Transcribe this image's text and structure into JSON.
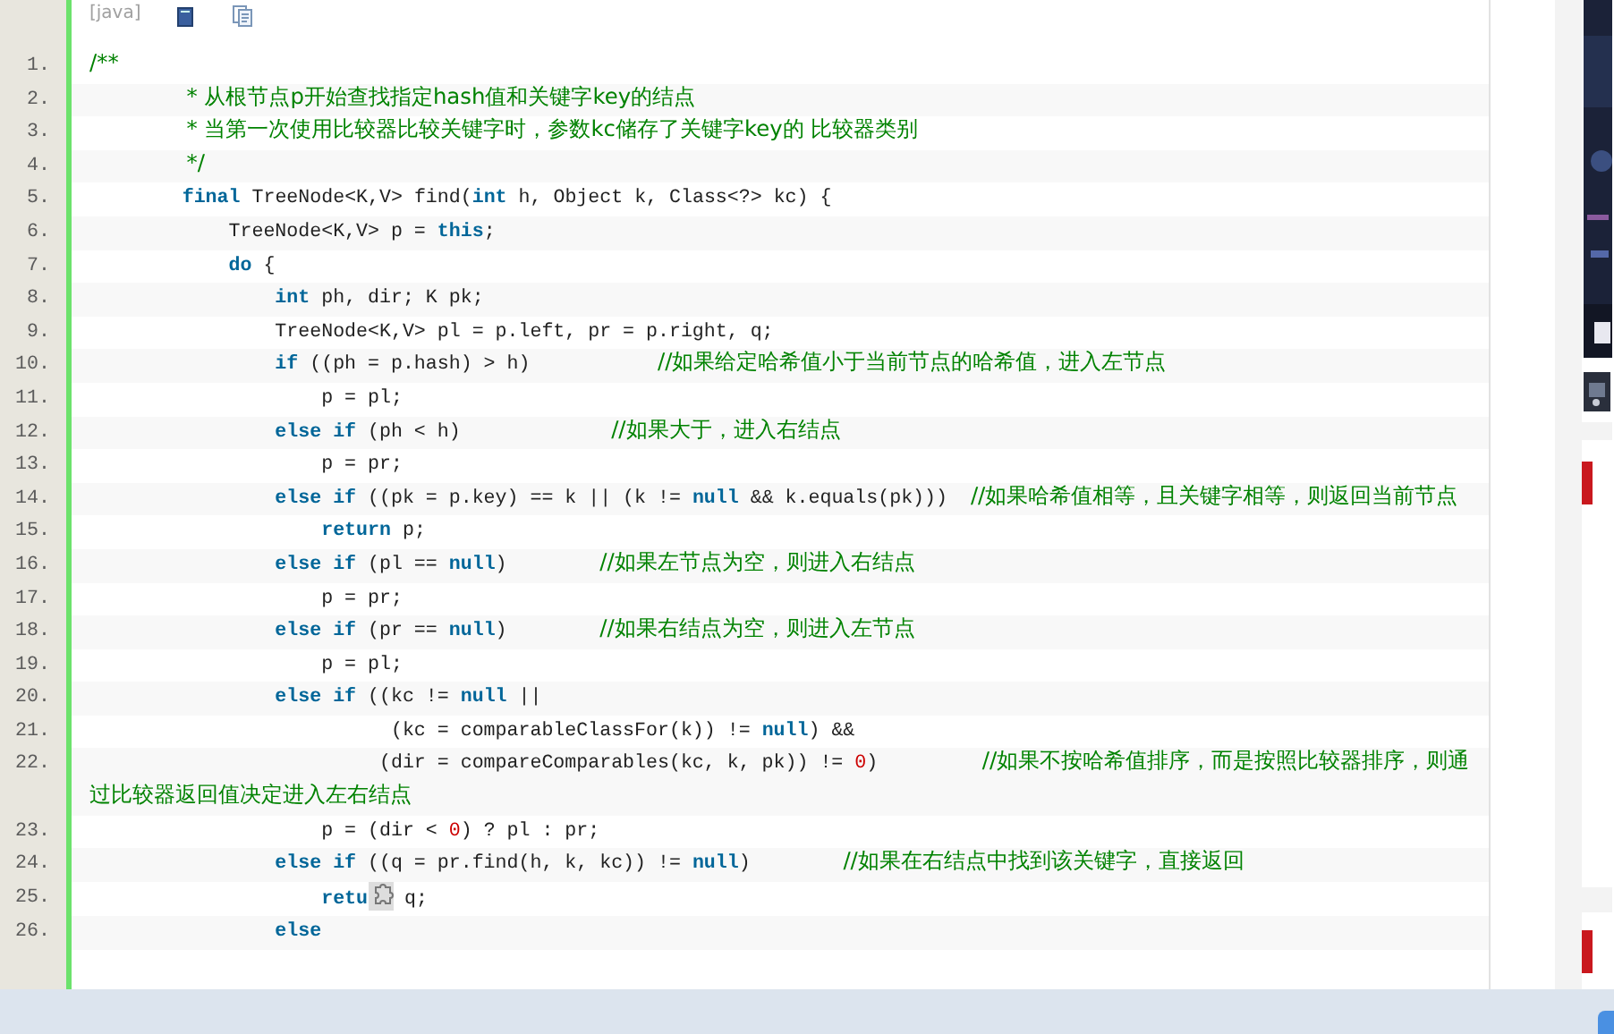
{
  "code_block": {
    "language": "[java]",
    "lines": [
      {
        "number": "1.",
        "segments": [
          {
            "kind": "comment",
            "text": "/**"
          }
        ]
      },
      {
        "number": "2.",
        "segments": [
          {
            "kind": "comment",
            "text": "              * 从根节点p开始查找指定hash值和关键字key的结点"
          }
        ]
      },
      {
        "number": "3.",
        "segments": [
          {
            "kind": "comment",
            "text": "              * 当第一次使用比较器比较关键字时，参数kc储存了关键字key的 比较器类别"
          }
        ]
      },
      {
        "number": "4.",
        "segments": [
          {
            "kind": "comment",
            "text": "              */"
          }
        ]
      },
      {
        "number": "5.",
        "segments": [
          {
            "kind": "keyword",
            "text": "        final"
          },
          {
            "kind": "plain",
            "text": " TreeNode<K,V> find("
          },
          {
            "kind": "keyword",
            "text": "int"
          },
          {
            "kind": "plain",
            "text": " h, Object k, Class<?> kc) {"
          }
        ]
      },
      {
        "number": "6.",
        "segments": [
          {
            "kind": "plain",
            "text": "            TreeNode<K,V> p = "
          },
          {
            "kind": "keyword",
            "text": "this"
          },
          {
            "kind": "plain",
            "text": ";"
          }
        ]
      },
      {
        "number": "7.",
        "segments": [
          {
            "kind": "keyword",
            "text": "            do"
          },
          {
            "kind": "plain",
            "text": " {"
          }
        ]
      },
      {
        "number": "8.",
        "segments": [
          {
            "kind": "keyword",
            "text": "                int"
          },
          {
            "kind": "plain",
            "text": " ph, dir; K pk;"
          }
        ]
      },
      {
        "number": "9.",
        "segments": [
          {
            "kind": "plain",
            "text": "                TreeNode<K,V> pl = p.left, pr = p.right, q;"
          }
        ]
      },
      {
        "number": "10.",
        "segments": [
          {
            "kind": "keyword",
            "text": "                if"
          },
          {
            "kind": "plain",
            "text": " ((ph = p.hash) > h)           "
          },
          {
            "kind": "comment",
            "text": "//如果给定哈希值小于当前节点的哈希值，进入左节点"
          }
        ]
      },
      {
        "number": "11.",
        "segments": [
          {
            "kind": "plain",
            "text": "                    p = pl;"
          }
        ]
      },
      {
        "number": "12.",
        "segments": [
          {
            "kind": "keyword",
            "text": "                else if"
          },
          {
            "kind": "plain",
            "text": " (ph < h)             "
          },
          {
            "kind": "comment",
            "text": "//如果大于，进入右结点"
          }
        ]
      },
      {
        "number": "13.",
        "segments": [
          {
            "kind": "plain",
            "text": "                    p = pr;"
          }
        ]
      },
      {
        "number": "14.",
        "segments": [
          {
            "kind": "keyword",
            "text": "                else if"
          },
          {
            "kind": "plain",
            "text": " ((pk = p.key) == k || (k != "
          },
          {
            "kind": "keyword",
            "text": "null"
          },
          {
            "kind": "plain",
            "text": " && k.equals(pk)))  "
          },
          {
            "kind": "comment",
            "text": "//如果哈希值相等，且关键字相等，则返回当前节点"
          }
        ]
      },
      {
        "number": "15.",
        "segments": [
          {
            "kind": "keyword",
            "text": "                    return"
          },
          {
            "kind": "plain",
            "text": " p;"
          }
        ]
      },
      {
        "number": "16.",
        "segments": [
          {
            "kind": "keyword",
            "text": "                else if"
          },
          {
            "kind": "plain",
            "text": " (pl == "
          },
          {
            "kind": "keyword",
            "text": "null"
          },
          {
            "kind": "plain",
            "text": ")        "
          },
          {
            "kind": "comment",
            "text": "//如果左节点为空，则进入右结点"
          }
        ]
      },
      {
        "number": "17.",
        "segments": [
          {
            "kind": "plain",
            "text": "                    p = pr;"
          }
        ]
      },
      {
        "number": "18.",
        "segments": [
          {
            "kind": "keyword",
            "text": "                else if"
          },
          {
            "kind": "plain",
            "text": " (pr == "
          },
          {
            "kind": "keyword",
            "text": "null"
          },
          {
            "kind": "plain",
            "text": ")        "
          },
          {
            "kind": "comment",
            "text": "//如果右结点为空，则进入左节点"
          }
        ]
      },
      {
        "number": "19.",
        "segments": [
          {
            "kind": "plain",
            "text": "                    p = pl;"
          }
        ]
      },
      {
        "number": "20.",
        "segments": [
          {
            "kind": "keyword",
            "text": "                else if"
          },
          {
            "kind": "plain",
            "text": " ((kc != "
          },
          {
            "kind": "keyword",
            "text": "null"
          },
          {
            "kind": "plain",
            "text": " ||"
          }
        ]
      },
      {
        "number": "21.",
        "segments": [
          {
            "kind": "plain",
            "text": "                          (kc = comparableClassFor(k)) != "
          },
          {
            "kind": "keyword",
            "text": "null"
          },
          {
            "kind": "plain",
            "text": ") &&"
          }
        ]
      },
      {
        "number": "22.",
        "segments": [
          {
            "kind": "plain",
            "text": "                         (dir = compareComparables(kc, k, pk)) != "
          },
          {
            "kind": "number",
            "text": "0"
          },
          {
            "kind": "plain",
            "text": ")         "
          },
          {
            "kind": "comment",
            "text": "//如果不按哈希值排序，而是按照比较器排序，则通过比较器返回值决定进入左右结点"
          }
        ]
      },
      {
        "number": "23.",
        "segments": [
          {
            "kind": "plain",
            "text": "                    p = (dir < "
          },
          {
            "kind": "number",
            "text": "0"
          },
          {
            "kind": "plain",
            "text": ") ? pl : pr;"
          }
        ]
      },
      {
        "number": "24.",
        "segments": [
          {
            "kind": "keyword",
            "text": "                else if"
          },
          {
            "kind": "plain",
            "text": " ((q = pr.find(h, k, kc)) != "
          },
          {
            "kind": "keyword",
            "text": "null"
          },
          {
            "kind": "plain",
            "text": ")        "
          },
          {
            "kind": "comment",
            "text": "//如果在右结点中找到该关键字，直接返回"
          }
        ]
      },
      {
        "number": "25.",
        "segments": [
          {
            "kind": "keyword",
            "text": "                    retu"
          },
          {
            "kind": "icon"
          },
          {
            "kind": "plain",
            "text": " q;"
          }
        ]
      },
      {
        "number": "26.",
        "segments": [
          {
            "kind": "keyword",
            "text": "                else"
          }
        ]
      }
    ]
  }
}
